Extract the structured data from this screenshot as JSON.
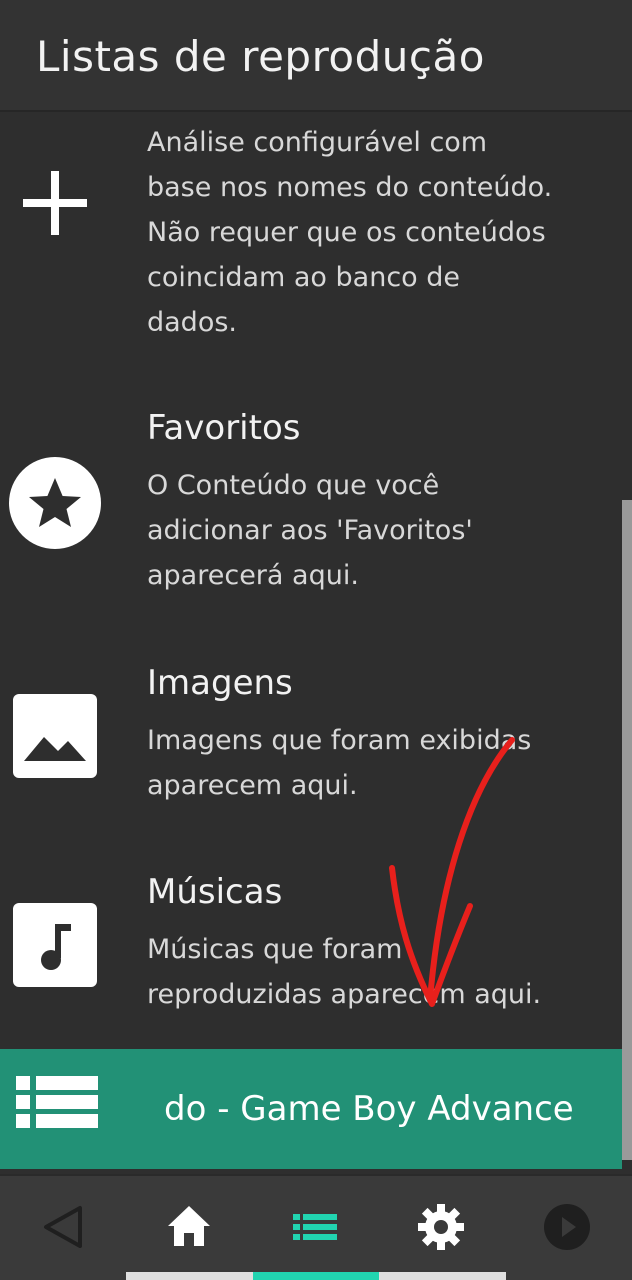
{
  "header": {
    "title": "Listas de reprodução"
  },
  "items": [
    {
      "icon": "plus-icon",
      "title": "",
      "description": [
        "Análise configurável com",
        "base nos nomes do conteúdo.",
        "Não requer que os conteúdos",
        "coincidam ao banco de",
        "dados."
      ]
    },
    {
      "icon": "star-icon",
      "title": "Favoritos",
      "description": [
        "O Conteúdo que você",
        "adicionar aos 'Favoritos'",
        "aparecerá aqui."
      ]
    },
    {
      "icon": "image-icon",
      "title": "Imagens",
      "description": [
        "Imagens que foram exibidas",
        "aparecem aqui."
      ]
    },
    {
      "icon": "music-icon",
      "title": "Músicas",
      "description": [
        "Músicas que foram",
        "reproduzidas aparecem aqui."
      ]
    }
  ],
  "selected_playlist": {
    "icon": "list-icon",
    "label": "do - Game Boy Advance"
  },
  "navbar": {
    "buttons": [
      "back-icon",
      "home-icon",
      "playlists-icon",
      "settings-icon",
      "resume-icon"
    ],
    "active_index": 2
  },
  "colors": {
    "accent": "#229176",
    "active_tab": "#21d4b0",
    "background": "#2e2e2e",
    "annotation": "#e8201c"
  }
}
